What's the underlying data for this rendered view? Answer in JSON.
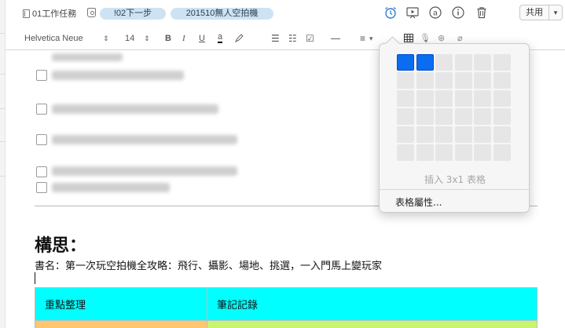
{
  "header": {
    "notebook": "01工作任務",
    "tags": [
      "!02下一步",
      "201510無人空拍機"
    ],
    "share_label": "共用",
    "icons": [
      "reminder-alarm-icon",
      "present-icon",
      "at-mention-icon",
      "info-icon",
      "trash-icon",
      "chevron-down-icon"
    ]
  },
  "format_bar": {
    "font_family": "Helvetica Neue",
    "font_size": "14",
    "bold": "B",
    "italic": "I",
    "underline": "U",
    "text_color": "a"
  },
  "note": {
    "heading": "構思：",
    "book_line": "書名：第一次玩空拍機全攻略：飛行、攝影、場地、挑選，一入門馬上變玩家",
    "table_headers": [
      "重點整理",
      "筆記記錄"
    ],
    "table_colors": {
      "header": "#00ffff",
      "cell1": "#ffc66d",
      "cell2": "#c8f56c"
    }
  },
  "table_popover": {
    "grid_columns": 6,
    "grid_rows": 6,
    "selected_columns": 2,
    "selected_rows": 1,
    "insert_label": "插入 3x1 表格",
    "properties_label": "表格屬性...",
    "selection_color": "#0a6cf0"
  }
}
